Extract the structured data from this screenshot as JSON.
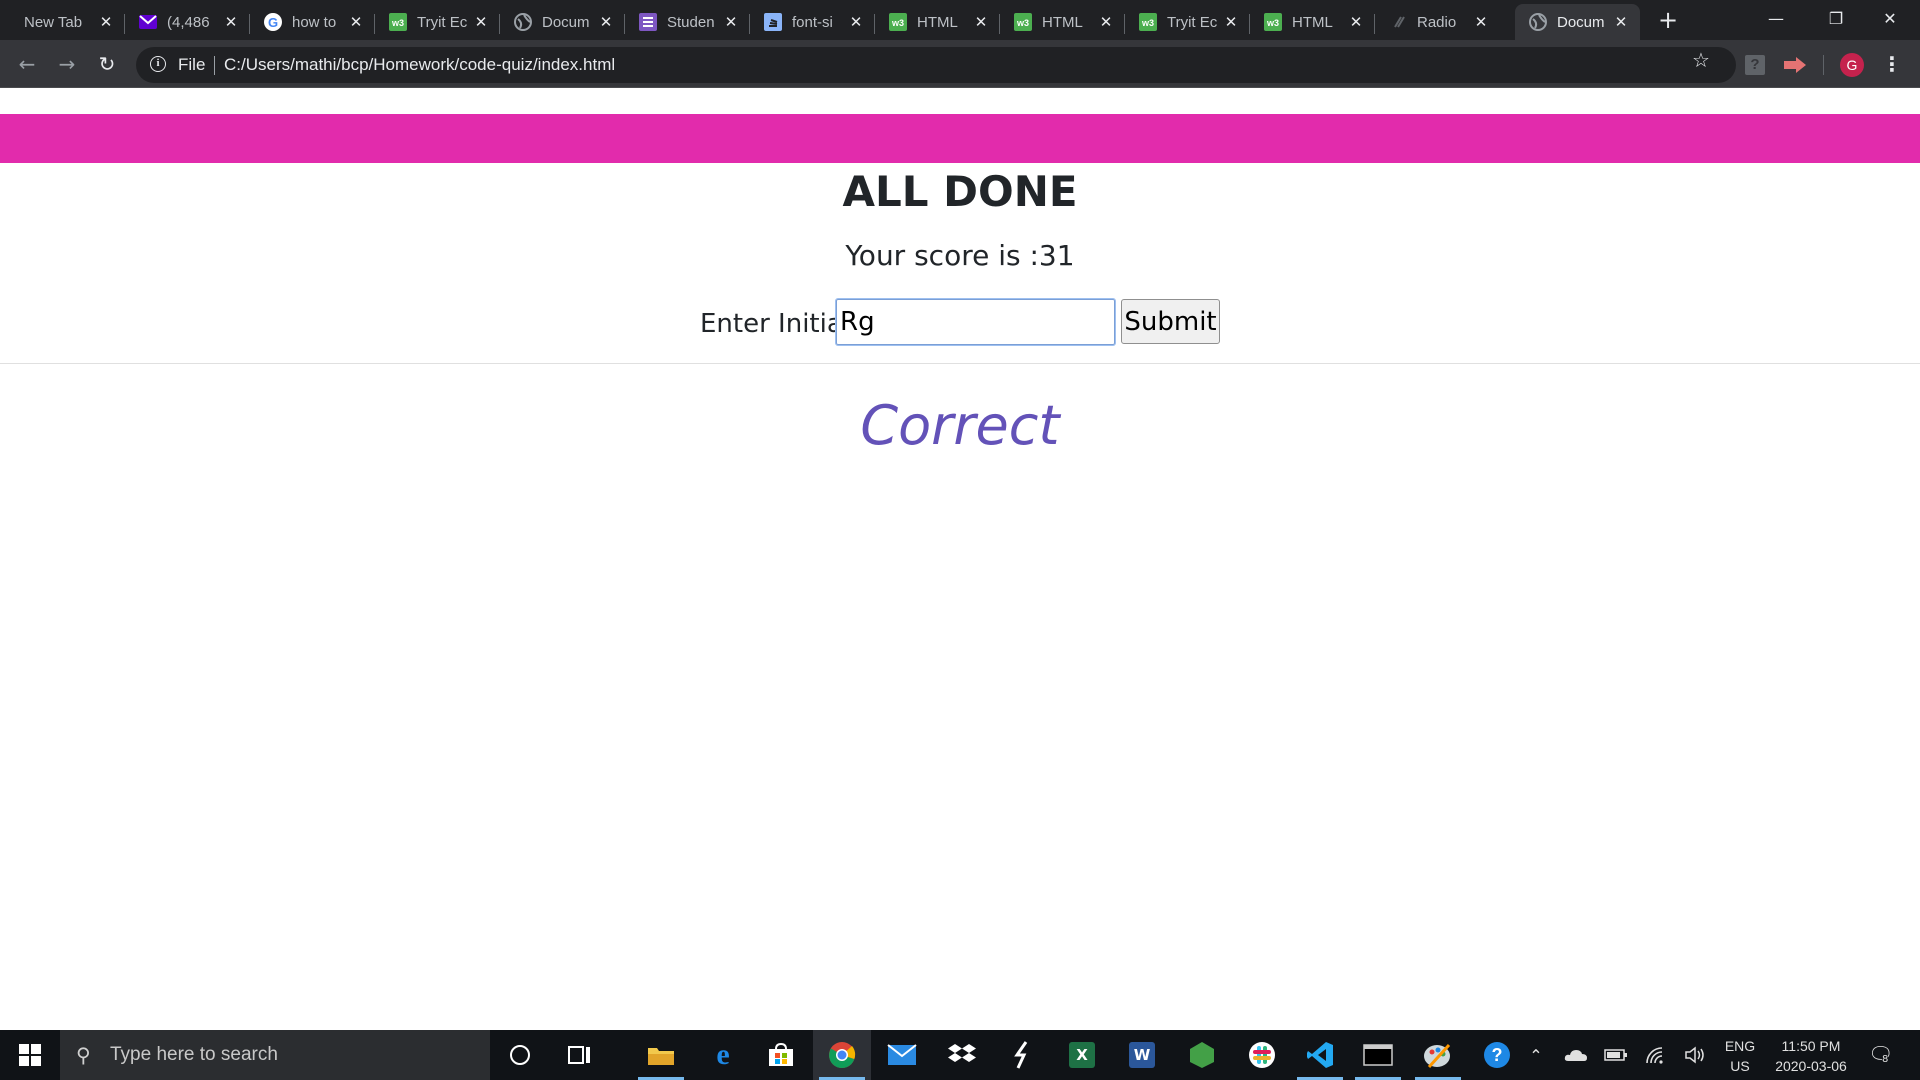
{
  "browser": {
    "tabs": [
      {
        "title": "New Tab",
        "icon": "none"
      },
      {
        "title": "(4,486",
        "icon": "yahoo-mail-icon"
      },
      {
        "title": "how to",
        "icon": "google-icon"
      },
      {
        "title": "Tryit Ec",
        "icon": "w3schools-icon"
      },
      {
        "title": "Docum",
        "icon": "globe-icon"
      },
      {
        "title": "Studen",
        "icon": "list-icon"
      },
      {
        "title": "font-si",
        "icon": "stackoverflow-icon"
      },
      {
        "title": "HTML",
        "icon": "w3schools-icon"
      },
      {
        "title": "HTML",
        "icon": "w3schools-icon"
      },
      {
        "title": "Tryit Ec",
        "icon": "w3schools-icon"
      },
      {
        "title": "HTML",
        "icon": "w3schools-icon"
      },
      {
        "title": "Radio",
        "icon": "link-icon"
      },
      {
        "title": "Docum",
        "icon": "globe-icon",
        "active": true
      }
    ],
    "new_tab_symbol": "+",
    "address": {
      "scheme_label": "File",
      "url": "C:/Users/mathi/bcp/Homework/code-quiz/index.html"
    },
    "profile_initial": "G"
  },
  "page": {
    "heading": "ALL DONE",
    "score_text": "Your score is :31",
    "initial_label": "Enter Initial:",
    "initial_value": "Rg",
    "submit_label": "Submit",
    "result_text": "Correct",
    "colors": {
      "header_bar": "#e22bac",
      "result_text": "#6352b8"
    }
  },
  "taskbar": {
    "search_placeholder": "Type here to search",
    "language": "ENG",
    "region": "US",
    "time": "11:50 PM",
    "date": "2020-03-06",
    "notification_count": "8"
  }
}
